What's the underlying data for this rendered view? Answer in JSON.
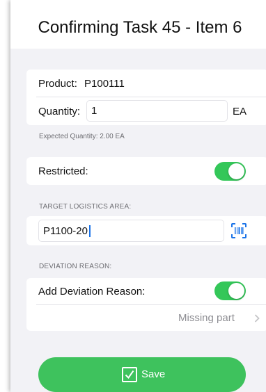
{
  "header": {
    "title": "Confirming Task 45 - Item 6"
  },
  "product": {
    "label": "Product:",
    "value": "P100111"
  },
  "quantity": {
    "label": "Quantity:",
    "value": "1",
    "unit": "EA"
  },
  "expected_quantity": "Expected Quantity: 2.00 EA",
  "restricted": {
    "label": "Restricted:",
    "on": true
  },
  "target_area": {
    "header": "TARGET LOGISTICS AREA:",
    "value": "P1100-20",
    "scan_icon": "barcode-scan-icon"
  },
  "deviation": {
    "header": "DEVIATION REASON:",
    "label": "Add Deviation Reason:",
    "on": true,
    "reason": "Missing part"
  },
  "save": {
    "label": "Save",
    "icon": "checkbox-check-icon"
  },
  "colors": {
    "accent_green": "#34c759",
    "button_green": "#3ec25d",
    "scan_blue": "#1a73e8",
    "background": "#f2f2f6"
  }
}
